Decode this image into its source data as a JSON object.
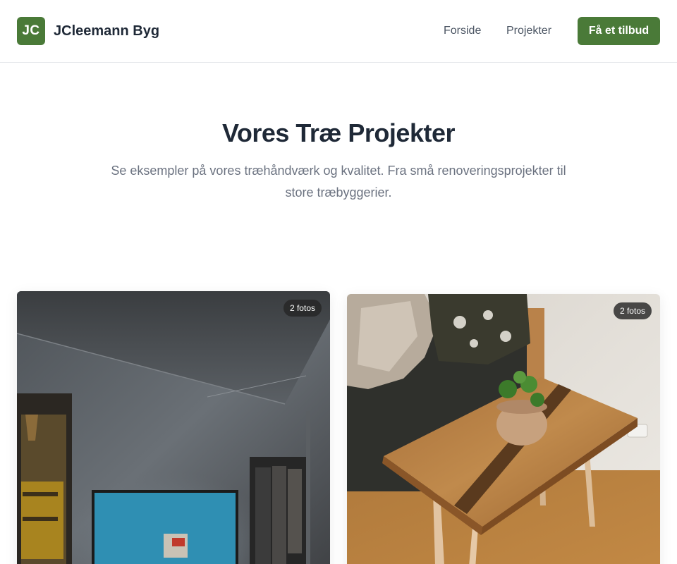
{
  "header": {
    "logo_initials": "JC",
    "brand_name": "JCleemann Byg",
    "nav": {
      "home": "Forside",
      "projects": "Projekter"
    },
    "cta_label": "Få et tilbud"
  },
  "hero": {
    "title": "Vores Træ Projekter",
    "subtitle": "Se eksempler på vores træhåndværk og kvalitet. Fra små renoveringsprojekter til store træbyggerier."
  },
  "projects": [
    {
      "photo_count_label": "2 fotos"
    },
    {
      "photo_count_label": "2 fotos"
    }
  ],
  "colors": {
    "brand_green": "#4a7a38",
    "heading": "#1f2937",
    "muted_text": "#6b7280"
  }
}
